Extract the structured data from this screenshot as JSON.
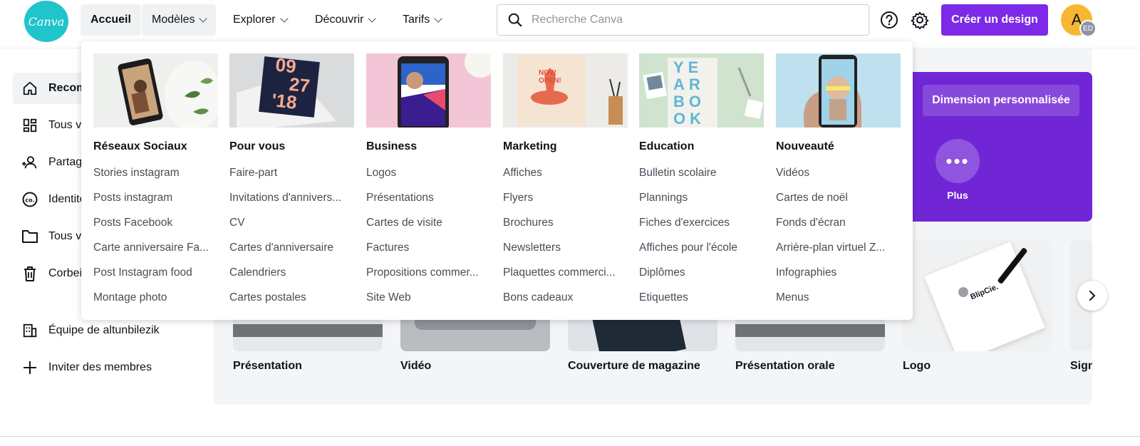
{
  "header": {
    "logo_text": "Canva",
    "nav": [
      {
        "label": "Accueil"
      },
      {
        "label": "Modèles"
      },
      {
        "label": "Explorer"
      },
      {
        "label": "Découvrir"
      },
      {
        "label": "Tarifs"
      }
    ],
    "search_placeholder": "Recherche Canva",
    "create_label": "Créer un design",
    "avatar_initial": "A",
    "avatar_badge": "ED"
  },
  "sidebar": {
    "items": [
      {
        "label": "Recommandé",
        "icon": "home-icon"
      },
      {
        "label": "Tous vos designs",
        "icon": "grid-icon"
      },
      {
        "label": "Partagé avec vous",
        "icon": "people-icon"
      },
      {
        "label": "Identité visuelle",
        "icon": "brand-icon"
      },
      {
        "label": "Tous vos dossiers",
        "icon": "folder-icon"
      },
      {
        "label": "Corbeille",
        "icon": "trash-icon"
      }
    ],
    "team_label": "Équipe de altunbilezik",
    "invite_label": "Inviter des membres"
  },
  "banner": {
    "custom_size_label": "Dimension personnalisée",
    "more_label": "Plus"
  },
  "cards": [
    {
      "label": "Présentation"
    },
    {
      "label": "Vidéo"
    },
    {
      "label": "Couverture de magazine"
    },
    {
      "label": "Présentation orale"
    },
    {
      "label": "Logo"
    },
    {
      "label": "Sign"
    }
  ],
  "menu": {
    "columns": [
      {
        "title": "Réseaux Sociaux",
        "links": [
          "Stories instagram",
          "Posts instagram",
          "Posts Facebook",
          "Carte anniversaire Fa...",
          "Post Instagram food",
          "Montage photo"
        ]
      },
      {
        "title": "Pour vous",
        "links": [
          "Faire-part",
          "Invitations d'annivers...",
          "CV",
          "Cartes d'anniversaire",
          "Calendriers",
          "Cartes postales"
        ]
      },
      {
        "title": "Business",
        "links": [
          "Logos",
          "Présentations",
          "Cartes de visite",
          "Factures",
          "Propositions commer...",
          "Site Web"
        ]
      },
      {
        "title": "Marketing",
        "links": [
          "Affiches",
          "Flyers",
          "Brochures",
          "Newsletters",
          "Plaquettes commerci...",
          "Bons cadeaux"
        ]
      },
      {
        "title": "Education",
        "links": [
          "Bulletin scolaire",
          "Plannings",
          "Fiches d'exercices",
          "Affiches pour l'école",
          "Diplômes",
          "Etiquettes"
        ]
      },
      {
        "title": "Nouveauté",
        "links": [
          "Vidéos",
          "Cartes de noël",
          "Fonds d'écran",
          "Arrière-plan virtuel Z...",
          "Infographies",
          "Menus"
        ]
      }
    ],
    "thumb_texts": {
      "calendar_line1": "09",
      "calendar_line2": "27",
      "calendar_line3": "'18",
      "yearbook": "YEARBOOK",
      "now_open": "NOW OPEN!",
      "blipcie": "BlipCie."
    }
  },
  "colors": {
    "brand_teal": "#20c4cb",
    "primary_purple": "#7d2ae8",
    "banner_purple": "#7126d6"
  }
}
